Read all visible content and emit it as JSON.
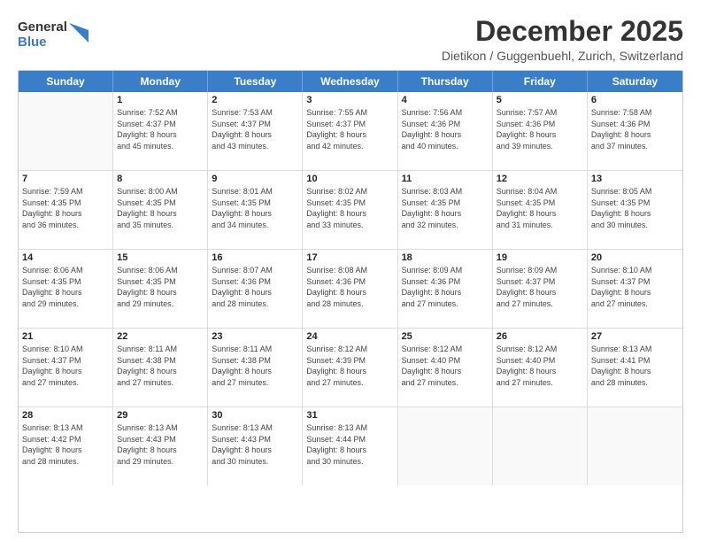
{
  "header": {
    "logo": {
      "line1": "General",
      "line2": "Blue"
    },
    "title": "December 2025",
    "location": "Dietikon / Guggenbuehl, Zurich, Switzerland"
  },
  "weekdays": [
    "Sunday",
    "Monday",
    "Tuesday",
    "Wednesday",
    "Thursday",
    "Friday",
    "Saturday"
  ],
  "rows": [
    [
      {
        "day": "",
        "info": ""
      },
      {
        "day": "1",
        "info": "Sunrise: 7:52 AM\nSunset: 4:37 PM\nDaylight: 8 hours\nand 45 minutes."
      },
      {
        "day": "2",
        "info": "Sunrise: 7:53 AM\nSunset: 4:37 PM\nDaylight: 8 hours\nand 43 minutes."
      },
      {
        "day": "3",
        "info": "Sunrise: 7:55 AM\nSunset: 4:37 PM\nDaylight: 8 hours\nand 42 minutes."
      },
      {
        "day": "4",
        "info": "Sunrise: 7:56 AM\nSunset: 4:36 PM\nDaylight: 8 hours\nand 40 minutes."
      },
      {
        "day": "5",
        "info": "Sunrise: 7:57 AM\nSunset: 4:36 PM\nDaylight: 8 hours\nand 39 minutes."
      },
      {
        "day": "6",
        "info": "Sunrise: 7:58 AM\nSunset: 4:36 PM\nDaylight: 8 hours\nand 37 minutes."
      }
    ],
    [
      {
        "day": "7",
        "info": "Sunrise: 7:59 AM\nSunset: 4:35 PM\nDaylight: 8 hours\nand 36 minutes."
      },
      {
        "day": "8",
        "info": "Sunrise: 8:00 AM\nSunset: 4:35 PM\nDaylight: 8 hours\nand 35 minutes."
      },
      {
        "day": "9",
        "info": "Sunrise: 8:01 AM\nSunset: 4:35 PM\nDaylight: 8 hours\nand 34 minutes."
      },
      {
        "day": "10",
        "info": "Sunrise: 8:02 AM\nSunset: 4:35 PM\nDaylight: 8 hours\nand 33 minutes."
      },
      {
        "day": "11",
        "info": "Sunrise: 8:03 AM\nSunset: 4:35 PM\nDaylight: 8 hours\nand 32 minutes."
      },
      {
        "day": "12",
        "info": "Sunrise: 8:04 AM\nSunset: 4:35 PM\nDaylight: 8 hours\nand 31 minutes."
      },
      {
        "day": "13",
        "info": "Sunrise: 8:05 AM\nSunset: 4:35 PM\nDaylight: 8 hours\nand 30 minutes."
      }
    ],
    [
      {
        "day": "14",
        "info": "Sunrise: 8:06 AM\nSunset: 4:35 PM\nDaylight: 8 hours\nand 29 minutes."
      },
      {
        "day": "15",
        "info": "Sunrise: 8:06 AM\nSunset: 4:35 PM\nDaylight: 8 hours\nand 29 minutes."
      },
      {
        "day": "16",
        "info": "Sunrise: 8:07 AM\nSunset: 4:36 PM\nDaylight: 8 hours\nand 28 minutes."
      },
      {
        "day": "17",
        "info": "Sunrise: 8:08 AM\nSunset: 4:36 PM\nDaylight: 8 hours\nand 28 minutes."
      },
      {
        "day": "18",
        "info": "Sunrise: 8:09 AM\nSunset: 4:36 PM\nDaylight: 8 hours\nand 27 minutes."
      },
      {
        "day": "19",
        "info": "Sunrise: 8:09 AM\nSunset: 4:37 PM\nDaylight: 8 hours\nand 27 minutes."
      },
      {
        "day": "20",
        "info": "Sunrise: 8:10 AM\nSunset: 4:37 PM\nDaylight: 8 hours\nand 27 minutes."
      }
    ],
    [
      {
        "day": "21",
        "info": "Sunrise: 8:10 AM\nSunset: 4:37 PM\nDaylight: 8 hours\nand 27 minutes."
      },
      {
        "day": "22",
        "info": "Sunrise: 8:11 AM\nSunset: 4:38 PM\nDaylight: 8 hours\nand 27 minutes."
      },
      {
        "day": "23",
        "info": "Sunrise: 8:11 AM\nSunset: 4:38 PM\nDaylight: 8 hours\nand 27 minutes."
      },
      {
        "day": "24",
        "info": "Sunrise: 8:12 AM\nSunset: 4:39 PM\nDaylight: 8 hours\nand 27 minutes."
      },
      {
        "day": "25",
        "info": "Sunrise: 8:12 AM\nSunset: 4:40 PM\nDaylight: 8 hours\nand 27 minutes."
      },
      {
        "day": "26",
        "info": "Sunrise: 8:12 AM\nSunset: 4:40 PM\nDaylight: 8 hours\nand 27 minutes."
      },
      {
        "day": "27",
        "info": "Sunrise: 8:13 AM\nSunset: 4:41 PM\nDaylight: 8 hours\nand 28 minutes."
      }
    ],
    [
      {
        "day": "28",
        "info": "Sunrise: 8:13 AM\nSunset: 4:42 PM\nDaylight: 8 hours\nand 28 minutes."
      },
      {
        "day": "29",
        "info": "Sunrise: 8:13 AM\nSunset: 4:43 PM\nDaylight: 8 hours\nand 29 minutes."
      },
      {
        "day": "30",
        "info": "Sunrise: 8:13 AM\nSunset: 4:43 PM\nDaylight: 8 hours\nand 30 minutes."
      },
      {
        "day": "31",
        "info": "Sunrise: 8:13 AM\nSunset: 4:44 PM\nDaylight: 8 hours\nand 30 minutes."
      },
      {
        "day": "",
        "info": ""
      },
      {
        "day": "",
        "info": ""
      },
      {
        "day": "",
        "info": ""
      }
    ]
  ]
}
